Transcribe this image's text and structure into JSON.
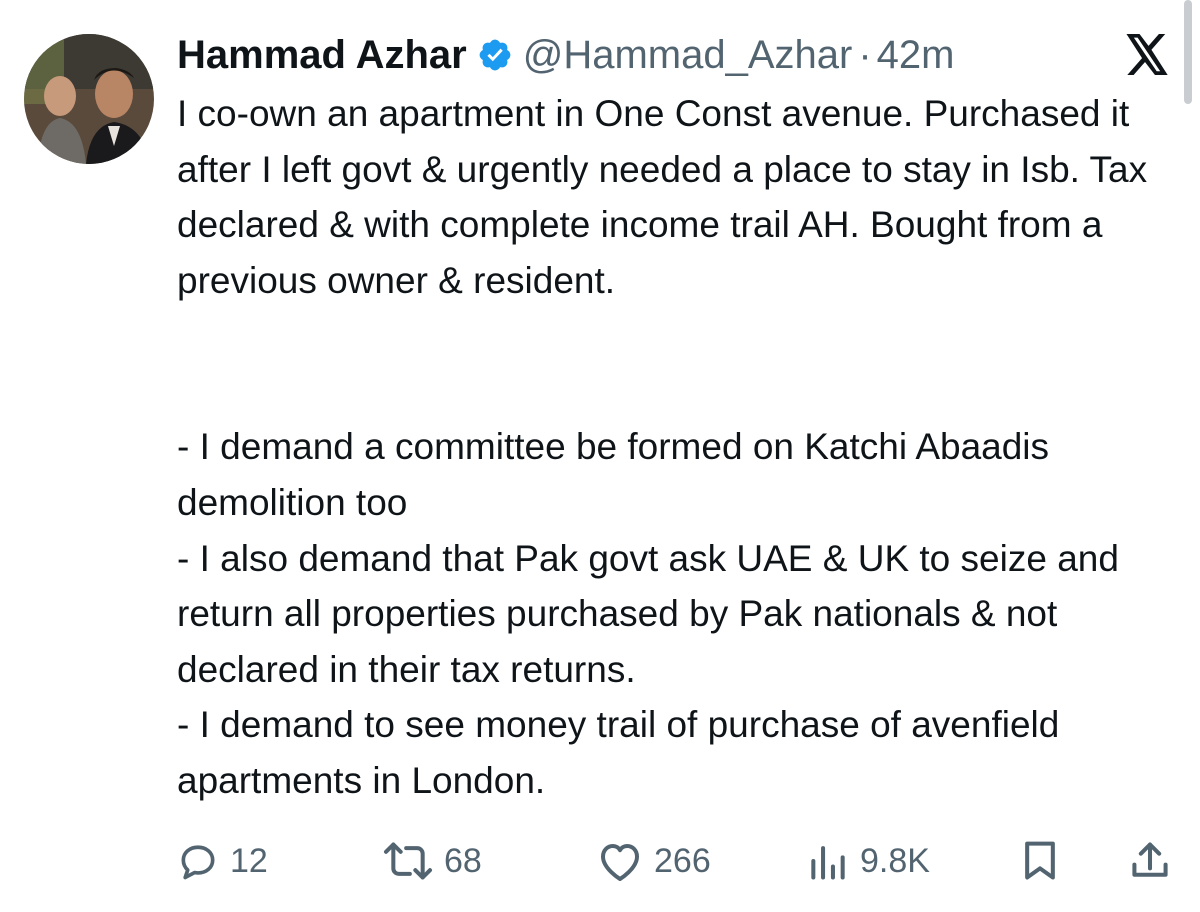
{
  "tweet": {
    "author": {
      "display_name": "Hammad Azhar",
      "handle": "@Hammad_Azhar",
      "verified": true
    },
    "separator": "·",
    "time": "42m",
    "text": {
      "paragraph_1": "I co-own an apartment in One Const avenue. Purchased it after I left govt & urgently needed a place to stay in Isb. Tax declared & with complete income trail AH. Bought from a previous owner & resident.",
      "line_2": "- I demand a committee be formed on Katchi Abaadis demolition too",
      "line_3": "- I also demand that Pak govt ask UAE & UK to seize and return all properties purchased by Pak nationals & not declared in their tax returns.",
      "line_4": "- I demand to see money trail of purchase of avenfield apartments in London."
    },
    "actions": {
      "replies": "12",
      "reposts": "68",
      "likes": "266",
      "views": "9.8K"
    }
  },
  "icons": {
    "reply": "reply-icon",
    "repost": "repost-icon",
    "like": "heart-icon",
    "views": "views-icon",
    "bookmark": "bookmark-icon",
    "share": "share-icon",
    "verified": "verified-badge-icon",
    "brand": "x-logo-icon"
  },
  "colors": {
    "text_primary": "#0f1419",
    "text_secondary": "#536471",
    "verified_blue": "#1d9bf0"
  }
}
